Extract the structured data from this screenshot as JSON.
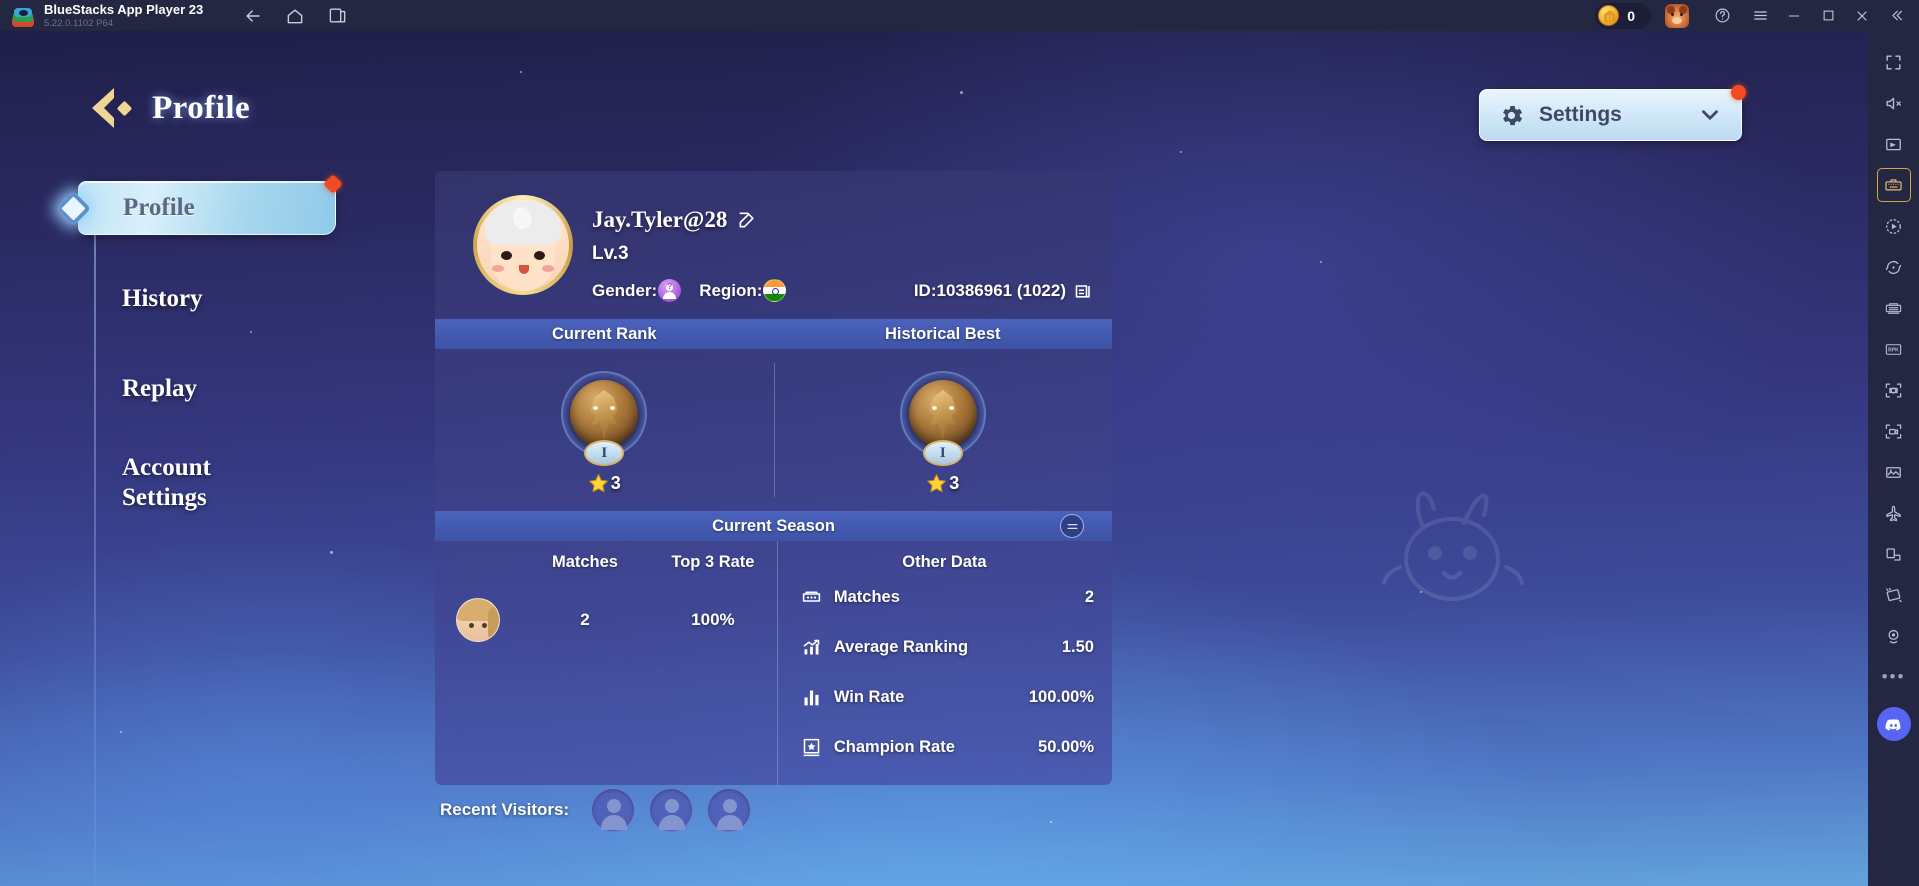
{
  "titlebar": {
    "app_name": "BlueStacks App Player 23",
    "version": "5.22.0.1102  P64",
    "nav": [
      {
        "name": "back-icon",
        "label": "Back"
      },
      {
        "name": "home-icon",
        "label": "Home"
      },
      {
        "name": "multi-instance-icon",
        "label": "Multi-instance"
      }
    ],
    "coin_value": "0",
    "right_controls": [
      "bear-avatar",
      "help-icon",
      "menu-icon",
      "minimize-icon",
      "maximize-icon",
      "close-icon",
      "collapse-icon"
    ]
  },
  "page": {
    "title": "Profile"
  },
  "sidebar": {
    "items": [
      {
        "label": "Profile",
        "active": true,
        "badge": true
      },
      {
        "label": "History",
        "active": false,
        "badge": false
      },
      {
        "label": "Replay",
        "active": false,
        "badge": false
      },
      {
        "label": "Account",
        "label2": "Settings",
        "active": false,
        "badge": false
      }
    ]
  },
  "settings_button": {
    "label": "Settings",
    "has_badge": true,
    "chevron": "chevron-down-icon"
  },
  "profile": {
    "username": "Jay.Tyler@28",
    "level": "Lv.3",
    "gender_label": "Gender:",
    "region_label": "Region:",
    "region_country": "India",
    "id_text": "ID:10386961 (1022)"
  },
  "rank": {
    "current_header": "Current Rank",
    "best_header": "Historical Best",
    "current": {
      "tier": "I",
      "stars": "3"
    },
    "best": {
      "tier": "I",
      "stars": "3"
    }
  },
  "season": {
    "header": "Current Season",
    "left_headers": [
      "Matches",
      "Top 3 Rate"
    ],
    "left_values": [
      "2",
      "100%"
    ],
    "right_header": "Other Data",
    "stats": [
      {
        "icon": "scoreboard-icon",
        "label": "Matches",
        "value": "2"
      },
      {
        "icon": "trend-chart-icon",
        "label": "Average Ranking",
        "value": "1.50"
      },
      {
        "icon": "bar-chart-icon",
        "label": "Win Rate",
        "value": "100.00%"
      },
      {
        "icon": "podium-icon",
        "label": "Champion Rate",
        "value": "50.00%"
      }
    ]
  },
  "visitors": {
    "label": "Recent Visitors:",
    "count": 3
  },
  "toolbar": {
    "items": [
      "fullscreen-icon",
      "mute-icon",
      "gamepad-icon",
      "keyboard-icon",
      "macro-play-icon",
      "sync-icon",
      "multi-control-icon",
      "rpg-mode-icon",
      "screenshot-icon",
      "record-video-icon",
      "media-manager-icon",
      "airplane-icon",
      "window-resize-icon",
      "tilt-icon",
      "location-icon",
      "more-icon",
      "discord-icon"
    ]
  },
  "colors": {
    "accent_gold": "#e0bd6a",
    "badge_red": "#f04b22",
    "bar_blue": "#4a63bc",
    "titlebar": "#242742",
    "settings_light": "#cfe6f7"
  }
}
